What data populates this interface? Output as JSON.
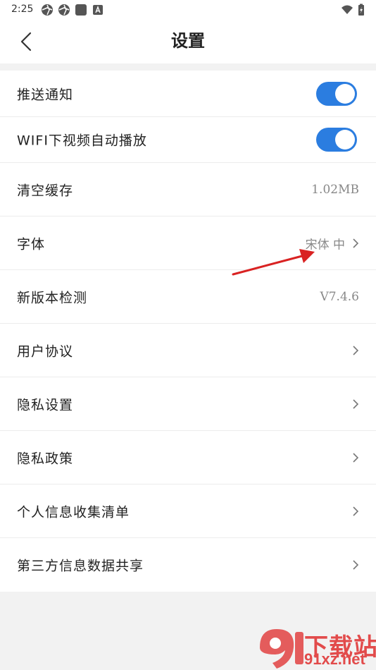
{
  "status_bar": {
    "time": "2:25",
    "left_icons": [
      "aperture-icon",
      "aperture-icon",
      "square-app-icon",
      "font-a-icon"
    ],
    "right_icons": [
      "wifi-icon",
      "battery-charging-icon"
    ]
  },
  "header": {
    "title": "设置",
    "back_icon": "chevron-left-icon"
  },
  "accent_color": "#2b7de0",
  "settings": {
    "push_notifications": {
      "label": "推送通知",
      "enabled": true
    },
    "wifi_autoplay": {
      "label": "WIFI下视频自动播放",
      "enabled": true
    },
    "clear_cache": {
      "label": "清空缓存",
      "value": "1.02MB"
    },
    "font": {
      "label": "字体",
      "value": "宋体 中"
    },
    "version_check": {
      "label": "新版本检测",
      "value": "V7.4.6"
    },
    "user_agreement": {
      "label": "用户协议"
    },
    "privacy_settings": {
      "label": "隐私设置"
    },
    "privacy_policy": {
      "label": "隐私政策"
    },
    "personal_info_list": {
      "label": "个人信息收集清单"
    },
    "third_party_sharing": {
      "label": "第三方信息数据共享"
    }
  },
  "watermark": {
    "logo_text": "下载站",
    "domain": "91xz.net"
  }
}
